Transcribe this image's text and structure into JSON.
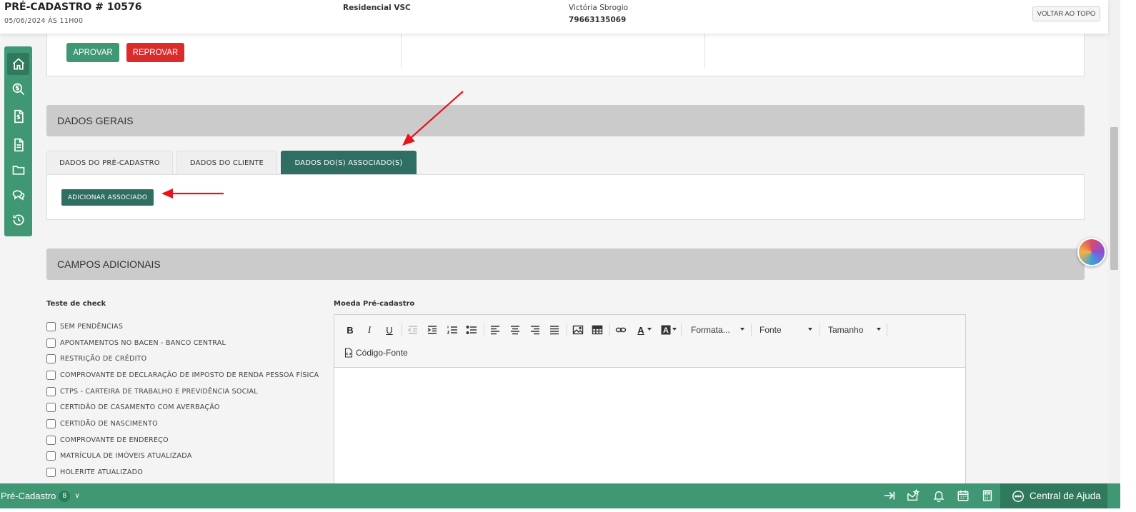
{
  "header": {
    "title": "PRÉ-CADASTRO # 10576",
    "date": "05/06/2024 ÀS 11H00",
    "project": "Residencial VSC",
    "client_name": "Victória Sbrogio",
    "client_phone": "79663135069",
    "back_to_top_label": "VOLTAR AO TOPO"
  },
  "sidebar": {
    "items": [
      {
        "icon": "home-icon"
      },
      {
        "icon": "money-search-icon"
      },
      {
        "icon": "invoice-icon"
      },
      {
        "icon": "document-icon"
      },
      {
        "icon": "folder-icon"
      },
      {
        "icon": "chat-icon"
      },
      {
        "icon": "history-icon"
      }
    ]
  },
  "approval": {
    "approve_label": "APROVAR",
    "reject_label": "REPROVAR"
  },
  "general": {
    "title": "DADOS GERAIS",
    "tabs": [
      {
        "label": "DADOS DO PRÉ-CADASTRO",
        "active": false
      },
      {
        "label": "DADOS DO CLIENTE",
        "active": false
      },
      {
        "label": "DADOS DO(S) ASSOCIADO(S)",
        "active": true
      }
    ],
    "add_associate_label": "ADICIONAR ASSOCIADO"
  },
  "additional": {
    "title": "CAMPOS ADICIONAIS",
    "check_label": "Teste de check",
    "checks": [
      "SEM PENDÊNCIAS",
      "APONTAMENTOS NO BACEN - BANCO CENTRAL",
      "RESTRIÇÃO DE CRÉDITO",
      "COMPROVANTE DE DECLARAÇÃO DE IMPOSTO DE RENDA PESSOA FÍSICA",
      "CTPS - CARTEIRA DE TRABALHO E PREVIDÊNCIA SOCIAL",
      "CERTIDÃO DE CASAMENTO COM AVERBAÇÃO",
      "CERTIDÃO DE NASCIMENTO",
      "COMPROVANTE DE ENDEREÇO",
      "MATRÍCULA DE IMÓVEIS ATUALIZADA",
      "HOLERITE ATUALIZADO"
    ],
    "currency_label": "Moeda Pré-cadastro",
    "editor": {
      "format_label": "Formata...",
      "font_label": "Fonte",
      "size_label": "Tamanho",
      "source_label": "Código-Fonte"
    }
  },
  "bottombar": {
    "module_label": "Pré-Cadastro",
    "module_count": "8",
    "help_label": "Central de Ajuda"
  },
  "colors": {
    "primary_green": "#3f9774",
    "dark_teal": "#2f6e62",
    "reject_red": "#dc2b2b",
    "annotation_red": "#e8141c"
  }
}
